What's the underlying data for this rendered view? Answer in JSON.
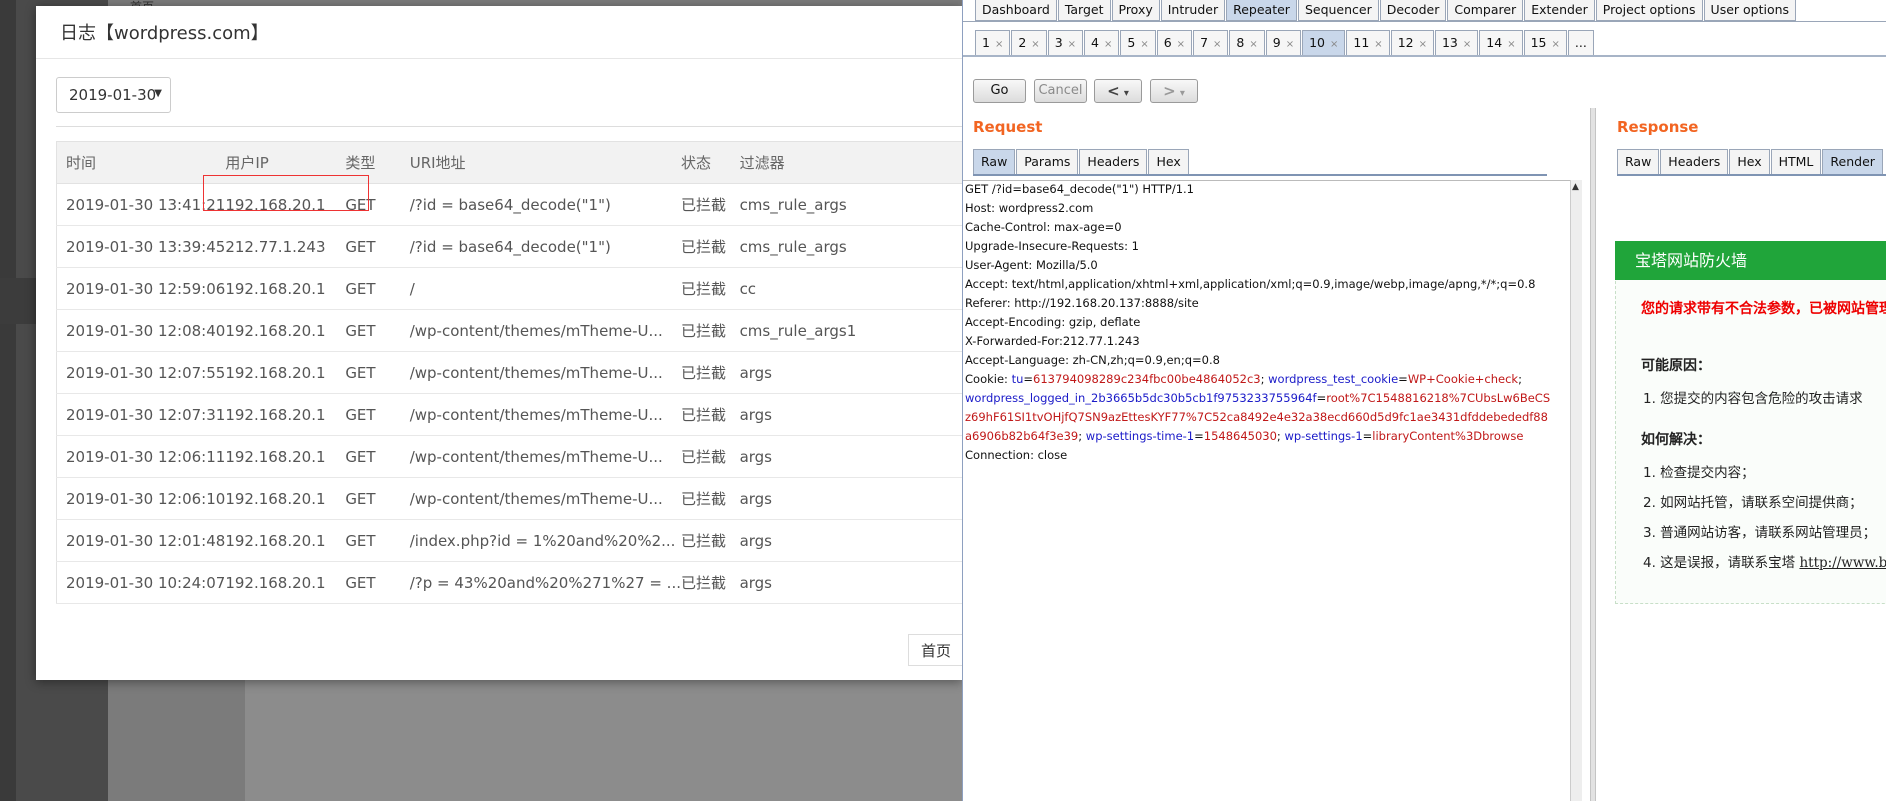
{
  "background": {
    "top_text": "首页"
  },
  "modal": {
    "title": "日志【wordpress.com】",
    "date_select": "2019-01-30",
    "columns": [
      "时间",
      "用户IP",
      "类型",
      "URI地址",
      "状态",
      "过滤器"
    ],
    "rows": [
      [
        "2019-01-30 13:41:21",
        "192.168.20.1",
        "GET",
        "/?id = base64_decode(\"1\")",
        "已拦截",
        "cms_rule_args"
      ],
      [
        "2019-01-30 13:39:45",
        "212.77.1.243",
        "GET",
        "/?id = base64_decode(\"1\")",
        "已拦截",
        "cms_rule_args"
      ],
      [
        "2019-01-30 12:59:06",
        "192.168.20.1",
        "GET",
        "/",
        "已拦截",
        "cc"
      ],
      [
        "2019-01-30 12:08:40",
        "192.168.20.1",
        "GET",
        "/wp-content/themes/mTheme-U...",
        "已拦截",
        "cms_rule_args1"
      ],
      [
        "2019-01-30 12:07:55",
        "192.168.20.1",
        "GET",
        "/wp-content/themes/mTheme-U...",
        "已拦截",
        "args"
      ],
      [
        "2019-01-30 12:07:31",
        "192.168.20.1",
        "GET",
        "/wp-content/themes/mTheme-U...",
        "已拦截",
        "args"
      ],
      [
        "2019-01-30 12:06:11",
        "192.168.20.1",
        "GET",
        "/wp-content/themes/mTheme-U...",
        "已拦截",
        "args"
      ],
      [
        "2019-01-30 12:06:10",
        "192.168.20.1",
        "GET",
        "/wp-content/themes/mTheme-U...",
        "已拦截",
        "args"
      ],
      [
        "2019-01-30 12:01:48",
        "192.168.20.1",
        "GET",
        "/index.php?id = 1%20and%20%2...",
        "已拦截",
        "args"
      ],
      [
        "2019-01-30 10:24:07",
        "192.168.20.1",
        "GET",
        "/?p = 43%20and%20%271%27 = ...",
        "已拦截",
        "args"
      ]
    ],
    "pager_first": "首页",
    "colors": {
      "ip": "#2db41f",
      "highlight": "#e33333"
    }
  },
  "burp": {
    "main_tabs": [
      "Dashboard",
      "Target",
      "Proxy",
      "Intruder",
      "Repeater",
      "Sequencer",
      "Decoder",
      "Comparer",
      "Extender",
      "Project options",
      "User options"
    ],
    "active_main_tab": "Repeater",
    "num_tabs": [
      "1",
      "2",
      "3",
      "4",
      "5",
      "6",
      "7",
      "8",
      "9",
      "10",
      "11",
      "12",
      "13",
      "14",
      "15"
    ],
    "active_num_tab": "10",
    "num_tabs_more": "...",
    "buttons": {
      "go": "Go",
      "cancel": "Cancel",
      "back": "<",
      "forward": ">",
      "dropdown": "▾"
    },
    "request": {
      "title": "Request",
      "tabs": [
        "Raw",
        "Params",
        "Headers",
        "Hex"
      ],
      "active_tab": "Raw",
      "lines": [
        "GET /?id=base64_decode(\"1\")  HTTP/1.1",
        "Host: wordpress2.com",
        "Cache-Control: max-age=0",
        "Upgrade-Insecure-Requests: 1",
        "User-Agent: Mozilla/5.0",
        "Accept: text/html,application/xhtml+xml,application/xml;q=0.9,image/webp,image/apng,*/*;q=0.8",
        "Referer: http://192.168.20.137:8888/site",
        "Accept-Encoding: gzip, deflate",
        "X-Forwarded-For:212.77.1.243",
        "Accept-Language: zh-CN,zh;q=0.9,en;q=0.8"
      ],
      "cookie": {
        "prefix": "Cookie: ",
        "tu_name": "tu",
        "tu_value": "613794098289c234fbc00be4864052c3",
        "sep": "; ",
        "wtc_name": "wordpress_test_cookie",
        "wtc_value": "WP+Cookie+check",
        "wli_name": "wordpress_logged_in_2b3665b5dc30b5cb1f9753233755964f",
        "wli_value_1": "root%7C1548816218%7CUbsLw6BeCS",
        "wli_value_2": "z69hF61SI1tvOHjfQ7SN9azEttesKYF77%7C52ca8492e4e32a38ecd660d5d9fc1ae3431dfddebededf88",
        "wli_value_3": "a6906b82b64f3e39",
        "wst_name": "wp-settings-time-1",
        "wst_value": "1548645030",
        "ws_name": "wp-settings-1",
        "ws_value": "libraryContent%3Dbrowse",
        "eq": "="
      },
      "last_line": "Connection: close",
      "scroll_arrow": "▲"
    },
    "response": {
      "title": "Response",
      "tabs": [
        "Raw",
        "Headers",
        "Hex",
        "HTML",
        "Render"
      ],
      "active_tab": "Render",
      "waf": {
        "header": "宝塔网站防火墙",
        "alert": "您的请求带有不合法参数，已被网站管理",
        "reason_title": "可能原因：",
        "reasons": [
          "1.  您提交的内容包含危险的攻击请求"
        ],
        "solve_title": "如何解决：",
        "solutions": [
          "1.  检查提交内容；",
          "2.  如网站托管，请联系空间提供商；",
          "3.  普通网站访客，请联系网站管理员；"
        ],
        "last_item": "4.  这是误报，请联系宝塔 ",
        "last_link": "http://www.b"
      }
    }
  }
}
